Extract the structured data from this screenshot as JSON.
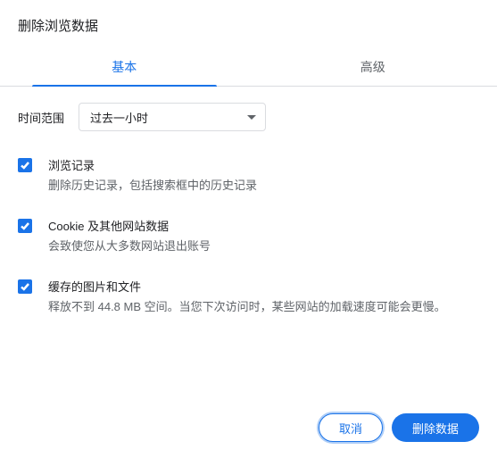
{
  "dialog": {
    "title": "删除浏览数据"
  },
  "tabs": {
    "basic": "基本",
    "advanced": "高级"
  },
  "timeRange": {
    "label": "时间范围",
    "value": "过去一小时"
  },
  "options": {
    "history": {
      "title": "浏览记录",
      "desc": "删除历史记录，包括搜索框中的历史记录"
    },
    "cookies": {
      "title": "Cookie 及其他网站数据",
      "desc": "会致使您从大多数网站退出账号"
    },
    "cache": {
      "title": "缓存的图片和文件",
      "desc": "释放不到 44.8 MB 空间。当您下次访问时，某些网站的加载速度可能会更慢。"
    }
  },
  "buttons": {
    "cancel": "取消",
    "confirm": "删除数据"
  }
}
